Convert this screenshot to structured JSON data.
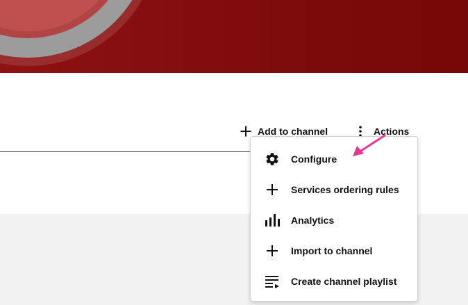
{
  "toolbar": {
    "add_label": "Add to channel",
    "add_icon": "plus-icon",
    "actions_label": "Actions",
    "actions_icon": "more-vertical-icon"
  },
  "actions_menu": {
    "items": [
      {
        "label": "Configure",
        "icon": "gear-icon"
      },
      {
        "label": "Services ordering rules",
        "icon": "plus-icon"
      },
      {
        "label": "Analytics",
        "icon": "bar-chart-icon"
      },
      {
        "label": "Import to channel",
        "icon": "plus-icon"
      },
      {
        "label": "Create channel playlist",
        "icon": "playlist-add-icon"
      }
    ]
  },
  "colors": {
    "banner": "#7e0b0b",
    "annotation_arrow": "#e8368f",
    "grey_area": "#f2f2f2"
  }
}
